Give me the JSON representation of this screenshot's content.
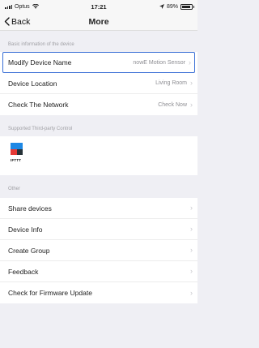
{
  "status_bar": {
    "carrier": "Optus",
    "time": "17:21",
    "battery": "89%",
    "battery_level": 0.89
  },
  "nav": {
    "back_label": "Back",
    "title": "More"
  },
  "sections": {
    "basic_header": "Basic information of the device",
    "basic_items": [
      {
        "label": "Modify Device Name",
        "value": "nowE Motion Sensor"
      },
      {
        "label": "Device Location",
        "value": "Living Room"
      },
      {
        "label": "Check The Network",
        "value": "Check Now"
      }
    ],
    "third_party_header": "Supported Third-party Control",
    "ifttt_label": "IFTTT",
    "other_header": "Other",
    "other_items": [
      {
        "label": "Share devices"
      },
      {
        "label": "Device Info"
      },
      {
        "label": "Create Group"
      },
      {
        "label": "Feedback"
      },
      {
        "label": "Check for Firmware Update"
      }
    ]
  },
  "icons": {
    "back": "chevron-left-icon",
    "row_arrow": "chevron-right-icon",
    "wifi": "wifi-icon",
    "location": "location-arrow-icon"
  },
  "colors": {
    "highlight_border": "#3a6fd6",
    "background": "#efeff4",
    "secondary_text": "#8e8e93"
  }
}
